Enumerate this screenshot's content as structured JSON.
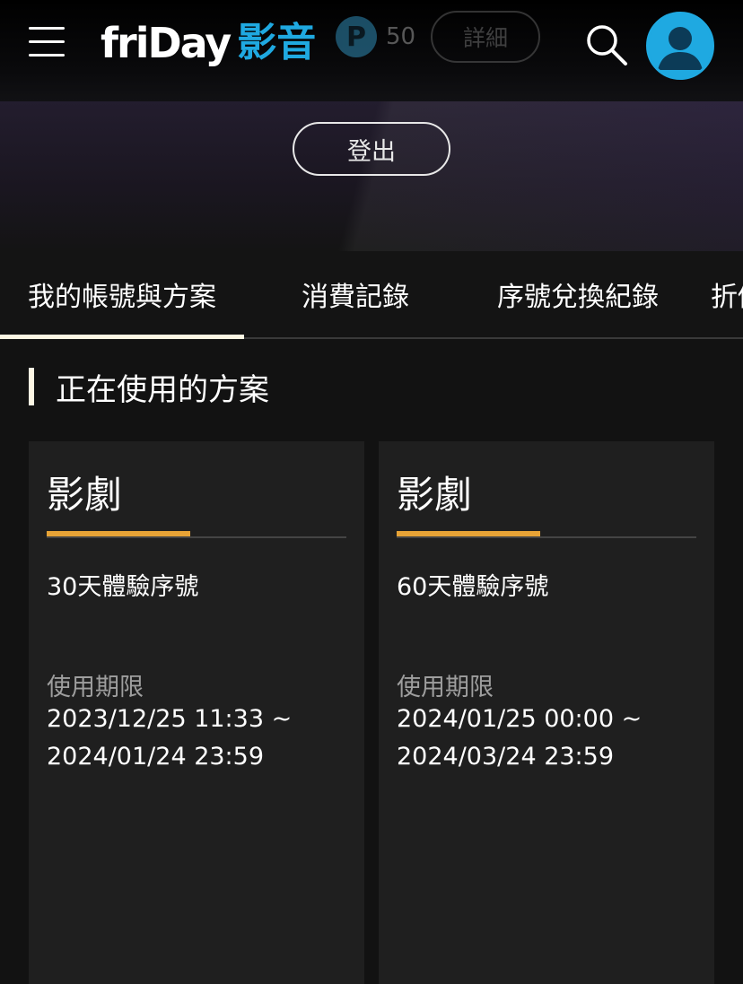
{
  "header": {
    "logo_text": "friDay",
    "logo_cn": "影音",
    "points_count": "50",
    "detail_label": "詳細"
  },
  "hero": {
    "logout_label": "登出"
  },
  "tabs": [
    {
      "label": "我的帳號與方案",
      "active": true
    },
    {
      "label": "消費記錄",
      "active": false
    },
    {
      "label": "序號兌換紀錄",
      "active": false
    },
    {
      "label": "折價",
      "active": false
    }
  ],
  "section": {
    "title": "正在使用的方案"
  },
  "plans": [
    {
      "category": "影劇",
      "name": "30天體驗序號",
      "period_label": "使用期限",
      "start": "2023/12/25 11:33 ~",
      "end": "2024/01/24 23:59"
    },
    {
      "category": "影劇",
      "name": "60天體驗序號",
      "period_label": "使用期限",
      "start": "2024/01/25 00:00 ~",
      "end": "2024/03/24 23:59"
    }
  ],
  "colors": {
    "brand_blue": "#1fa9e1",
    "accent_orange": "#e7a336",
    "tab_underline": "#fdf7e4"
  }
}
